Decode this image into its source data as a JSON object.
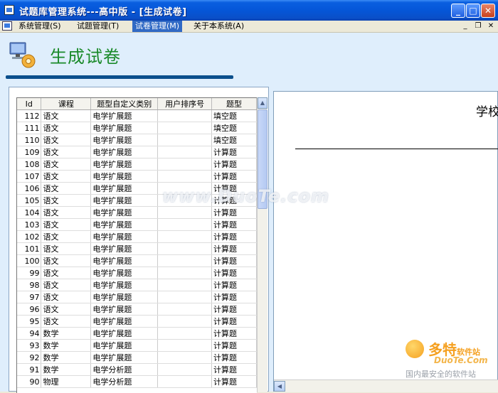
{
  "window": {
    "title": "试题库管理系统---高中版 - [生成试卷]",
    "buttons": {
      "minimize": "_",
      "maximize": "□",
      "close": "✕"
    }
  },
  "menu": {
    "items": [
      {
        "label": "系统管理(S)"
      },
      {
        "label": "试题管理(T)"
      },
      {
        "label": "试卷管理(M)"
      },
      {
        "label": "关于本系统(A)"
      }
    ],
    "mdi_controls": {
      "minimize": "_",
      "restore": "❐",
      "close": "✕"
    }
  },
  "header": {
    "page_title": "生成试卷",
    "logo_icon": "computer-gear-icon"
  },
  "grid": {
    "columns": [
      "Id",
      "课程",
      "题型自定义类别",
      "用户排序号",
      "题型"
    ],
    "rows": [
      [
        "112",
        "语文",
        "电学扩展题",
        "",
        "填空题"
      ],
      [
        "111",
        "语文",
        "电学扩展题",
        "",
        "填空题"
      ],
      [
        "110",
        "语文",
        "电学扩展题",
        "",
        "填空题"
      ],
      [
        "109",
        "语文",
        "电学扩展题",
        "",
        "计算题"
      ],
      [
        "108",
        "语文",
        "电学扩展题",
        "",
        "计算题"
      ],
      [
        "107",
        "语文",
        "电学扩展题",
        "",
        "计算题"
      ],
      [
        "106",
        "语文",
        "电学扩展题",
        "",
        "计算题"
      ],
      [
        "105",
        "语文",
        "电学扩展题",
        "",
        "计算题"
      ],
      [
        "104",
        "语文",
        "电学扩展题",
        "",
        "计算题"
      ],
      [
        "103",
        "语文",
        "电学扩展题",
        "",
        "计算题"
      ],
      [
        "102",
        "语文",
        "电学扩展题",
        "",
        "计算题"
      ],
      [
        "101",
        "语文",
        "电学扩展题",
        "",
        "计算题"
      ],
      [
        "100",
        "语文",
        "电学扩展题",
        "",
        "计算题"
      ],
      [
        "99",
        "语文",
        "电学扩展题",
        "",
        "计算题"
      ],
      [
        "98",
        "语文",
        "电学扩展题",
        "",
        "计算题"
      ],
      [
        "97",
        "语文",
        "电学扩展题",
        "",
        "计算题"
      ],
      [
        "96",
        "语文",
        "电学扩展题",
        "",
        "计算题"
      ],
      [
        "95",
        "语文",
        "电学扩展题",
        "",
        "计算题"
      ],
      [
        "94",
        "数学",
        "电学扩展题",
        "",
        "计算题"
      ],
      [
        "93",
        "数学",
        "电学扩展题",
        "",
        "计算题"
      ],
      [
        "92",
        "数学",
        "电学扩展题",
        "",
        "计算题"
      ],
      [
        "91",
        "数学",
        "电学分析题",
        "",
        "计算题"
      ],
      [
        "90",
        "物理",
        "电学分析题",
        "",
        "计算题"
      ]
    ]
  },
  "preview": {
    "heading": "学校"
  },
  "watermarks": {
    "center": "www.DuoTe.com",
    "brand": "多特",
    "brand_suffix": "软件站",
    "site": "DuoTe.Com",
    "tagline": "国内最安全的软件站"
  }
}
